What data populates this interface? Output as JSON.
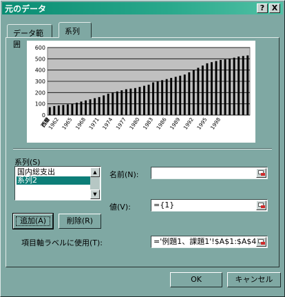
{
  "window": {
    "title": "元のデータ"
  },
  "titlebar": {
    "help_glyph": "?",
    "close_glyph": "X"
  },
  "tabs": [
    {
      "label": "データ範囲",
      "active": false
    },
    {
      "label": "系列",
      "active": true
    }
  ],
  "series_section": {
    "label": "系列(S)",
    "items": [
      {
        "label": "国内総支出",
        "selected": false
      },
      {
        "label": "系列2",
        "selected": true
      }
    ],
    "add_button": "追加(A)",
    "delete_button": "削除(R)"
  },
  "name_field": {
    "label": "名前(N):",
    "value": ""
  },
  "value_field": {
    "label": "値(V):",
    "value": "={1}"
  },
  "category_field": {
    "label": "項目軸ラベルに使用(T):",
    "value": "='例題1、課題1'!$A$1:$A$43"
  },
  "footer": {
    "ok": "OK",
    "cancel": "キャンセル"
  },
  "colors": {
    "chart_area": "#c0c0c0",
    "bar": "#000000",
    "selection": "#0d7e78",
    "title_bar": "#0a8d73"
  },
  "chart_data": {
    "type": "bar",
    "x": [
      "西暦",
      "1962",
      "1965",
      "1968",
      "1971",
      "1974",
      "1977",
      "1980",
      "1983",
      "1986",
      "1989",
      "1992",
      "1995",
      "1998"
    ],
    "x_tick_labels": [
      "西暦",
      "1962",
      "1965",
      "1968",
      "1971",
      "1974",
      "1977",
      "1980",
      "1983",
      "1986",
      "1989",
      "1992",
      "1995",
      "1998"
    ],
    "values": [
      70,
      80,
      85,
      90,
      95,
      100,
      110,
      120,
      130,
      140,
      150,
      160,
      175,
      190,
      200,
      210,
      220,
      230,
      235,
      240,
      250,
      260,
      270,
      290,
      300,
      310,
      320,
      330,
      340,
      350,
      360,
      380,
      400,
      420,
      440,
      460,
      470,
      480,
      490,
      495,
      500,
      510,
      520,
      525,
      530
    ],
    "ylim": [
      0,
      600
    ],
    "y_ticks": [
      0,
      100,
      200,
      300,
      400,
      500,
      600
    ],
    "grid": true,
    "legend": "none"
  }
}
